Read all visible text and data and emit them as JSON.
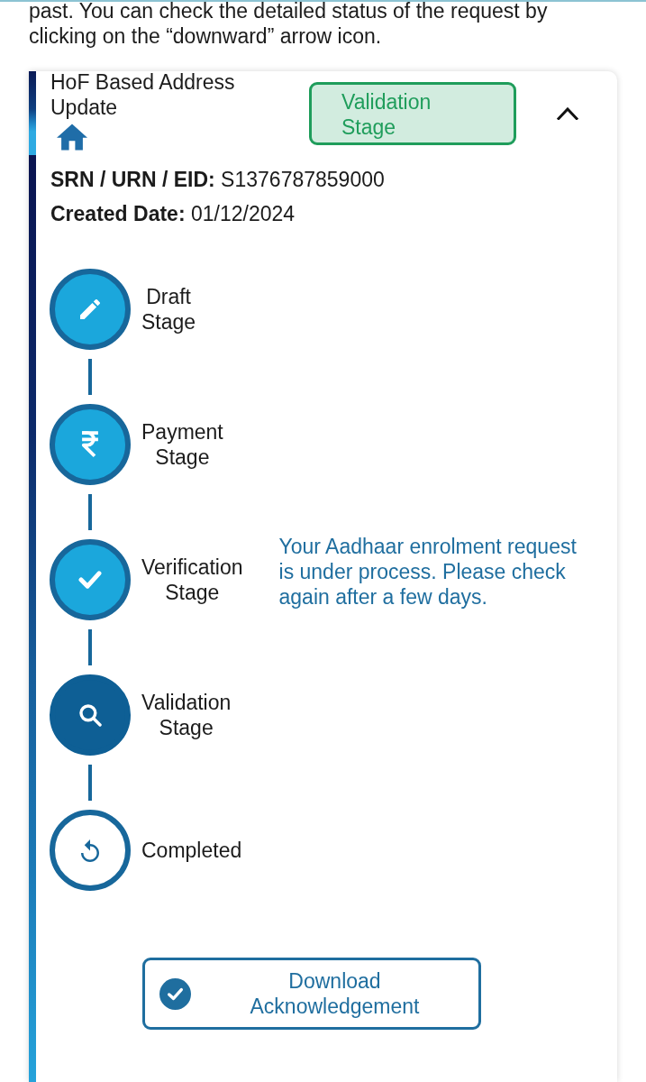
{
  "intro": {
    "text": "past. You can check the detailed status of the request by clicking on the “downward” arrow icon."
  },
  "request_card": {
    "title": "HoF Based Address Update",
    "status_badge": "Validation Stage",
    "expanded": true,
    "srn": "**SRN / URN / EID:** S1376787859000",
    "created_date": "**Created Date:** 01/12/2024",
    "stages": [
      {
        "label": "Draft Stage",
        "completed": true,
        "current": false
      },
      {
        "label": "Payment Stage",
        "completed": true,
        "current": false
      },
      {
        "label": "Verification Stage",
        "completed": true,
        "current": false,
        "message": "Your Aadhaar enrolment request is under process. Please check again after a few days."
      },
      {
        "label": "Validation Stage",
        "completed": false,
        "current": true
      },
      {
        "label": "Completed",
        "completed": false,
        "current": false
      }
    ],
    "download_button": {
      "label": "Download Acknowledgement"
    }
  }
}
